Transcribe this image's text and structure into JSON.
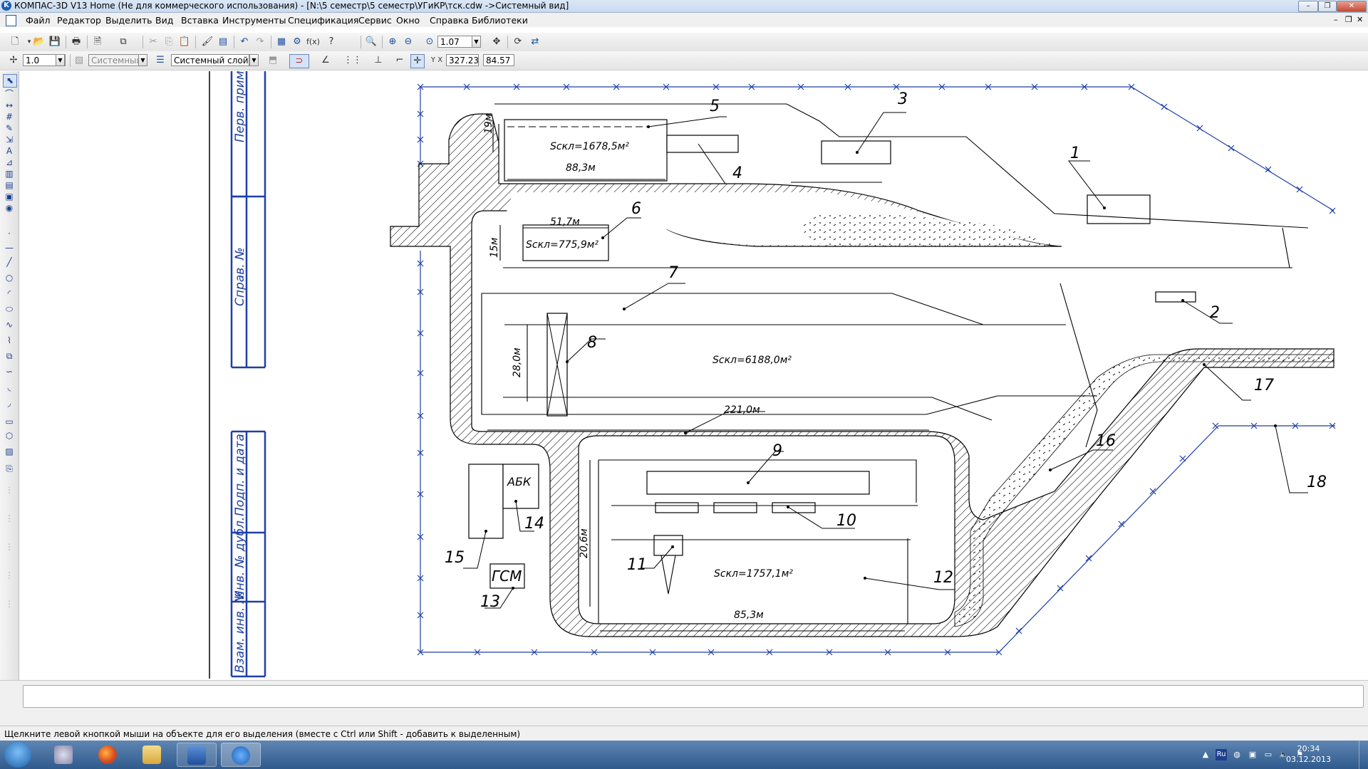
{
  "window": {
    "title": "КОМПАС-3D V13 Home (Не для коммерческого использования) - [N:\\5 семестр\\5 семестр\\УГиКР\\тск.cdw ->Системный вид]",
    "app_icon_glyph": "K",
    "minimize_glyph": "–",
    "restore_glyph": "❐",
    "close_glyph": "✕"
  },
  "menu": {
    "items": [
      "Файл",
      "Редактор",
      "Выделить",
      "Вид",
      "Вставка",
      "Инструменты",
      "Спецификация",
      "Сервис",
      "Окно",
      "Справка",
      "Библиотеки"
    ],
    "doc_controls": [
      "–",
      "❐",
      "✕"
    ]
  },
  "toolbar1": {
    "zoom_value": "1.07"
  },
  "toolbar2": {
    "step_value": "1.0",
    "style_value": "Системный",
    "layer_value": "Системный слой (",
    "coord_x": "327.23",
    "coord_y": "84.57",
    "xy_label": "Y X"
  },
  "stamp": {
    "label_perv": "Перв. примен.",
    "label_sprav": "Справ. №",
    "label_podp1": "Подп. и дата",
    "label_inv_dubl": "Инв. № дубл.",
    "label_vzam": "Взам. инв. №"
  },
  "drawing": {
    "labels": [
      "1",
      "2",
      "3",
      "4",
      "5",
      "6",
      "7",
      "8",
      "9",
      "10",
      "11",
      "12",
      "13",
      "14",
      "15",
      "16",
      "17",
      "18"
    ],
    "area_5": "Sскл=1678,5м²",
    "len_5": "88,3м",
    "width_5": "19м",
    "area_6": "Sскл=775,9м²",
    "len_6": "51,7м",
    "width_6": "15м",
    "area_7": "Sскл=6188,0м²",
    "len_7": "221,0м",
    "width_7": "28,0м",
    "area_12": "Sскл=1757,1м²",
    "len_12": "85,3м",
    "width_12": "20,6м",
    "abk": "АБК",
    "gsm": "ГСМ"
  },
  "status": {
    "hint": "Щелкните левой кнопкой мыши на объекте для его выделения (вместе с Ctrl или Shift - добавить к выделенным)"
  },
  "taskbar": {
    "lang": "Ru",
    "time": "20:34",
    "date": "03.12.2013"
  }
}
